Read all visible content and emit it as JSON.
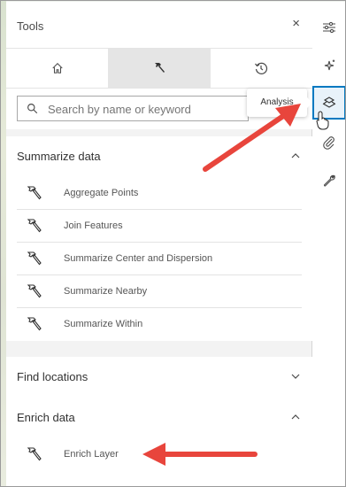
{
  "panel": {
    "title": "Tools",
    "close_glyph": "×"
  },
  "tabs": [
    {
      "name": "home-icon",
      "active": false
    },
    {
      "name": "hammer-icon",
      "active": true
    },
    {
      "name": "history-icon",
      "active": false
    }
  ],
  "search": {
    "placeholder": "Search by name or keyword",
    "value": ""
  },
  "sections": {
    "summarize": {
      "label": "Summarize data",
      "expanded": true,
      "items": [
        "Aggregate Points",
        "Join Features",
        "Summarize Center and Dispersion",
        "Summarize Nearby",
        "Summarize Within"
      ]
    },
    "find": {
      "label": "Find locations",
      "expanded": false
    },
    "enrich": {
      "label": "Enrich data",
      "expanded": true,
      "items": [
        "Enrich Layer"
      ]
    }
  },
  "actionbar": {
    "buttons": [
      {
        "name": "sliders-icon"
      },
      {
        "name": "sparkle-icon"
      },
      {
        "name": "analysis-icon",
        "active": true
      },
      {
        "name": "paperclip-icon"
      },
      {
        "name": "wrench-icon"
      }
    ],
    "tooltip": "Analysis"
  },
  "colors": {
    "accent": "#0079c1",
    "annotation_arrow": "#e8453c"
  }
}
